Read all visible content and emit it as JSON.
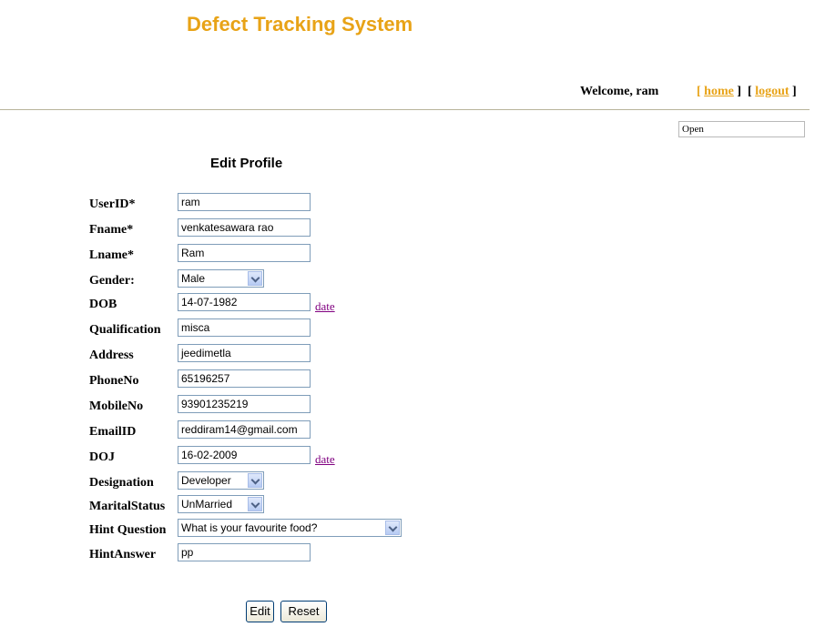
{
  "header": {
    "app_title": "Defect Tracking System"
  },
  "welcome": {
    "text": "Welcome,  ram",
    "home_label": "home",
    "logout_label": "logout",
    "bracket_open": "[",
    "bracket_close": "]"
  },
  "status": {
    "value": "Open"
  },
  "form": {
    "title": "Edit Profile",
    "fields": {
      "userid": {
        "label": "UserID*",
        "value": "ram"
      },
      "fname": {
        "label": "Fname*",
        "value": "venkatesawara rao"
      },
      "lname": {
        "label": "Lname*",
        "value": "Ram"
      },
      "gender": {
        "label": "Gender:",
        "value": "Male"
      },
      "dob": {
        "label": "DOB",
        "value": "14-07-1982",
        "link": "date"
      },
      "qualification": {
        "label": "Qualification",
        "value": "misca"
      },
      "address": {
        "label": "Address",
        "value": "jeedimetla"
      },
      "phone": {
        "label": "PhoneNo",
        "value": "65196257"
      },
      "mobile": {
        "label": "MobileNo",
        "value": "93901235219"
      },
      "email": {
        "label": "EmailID",
        "value": "reddiram14@gmail.com"
      },
      "doj": {
        "label": "DOJ",
        "value": "16-02-2009",
        "link": "date"
      },
      "designation": {
        "label": "Designation",
        "value": "Developer"
      },
      "marital": {
        "label": "MaritalStatus",
        "value": "UnMarried"
      },
      "hint_question": {
        "label": "Hint Question",
        "value": "What is your favourite food?"
      },
      "hint_answer": {
        "label": "HintAnswer",
        "value": "pp"
      }
    },
    "buttons": {
      "edit": "Edit",
      "reset": "Reset"
    }
  },
  "colors": {
    "accent": "#e8a317",
    "visited_link": "#800080",
    "divider": "#b8b39a"
  }
}
